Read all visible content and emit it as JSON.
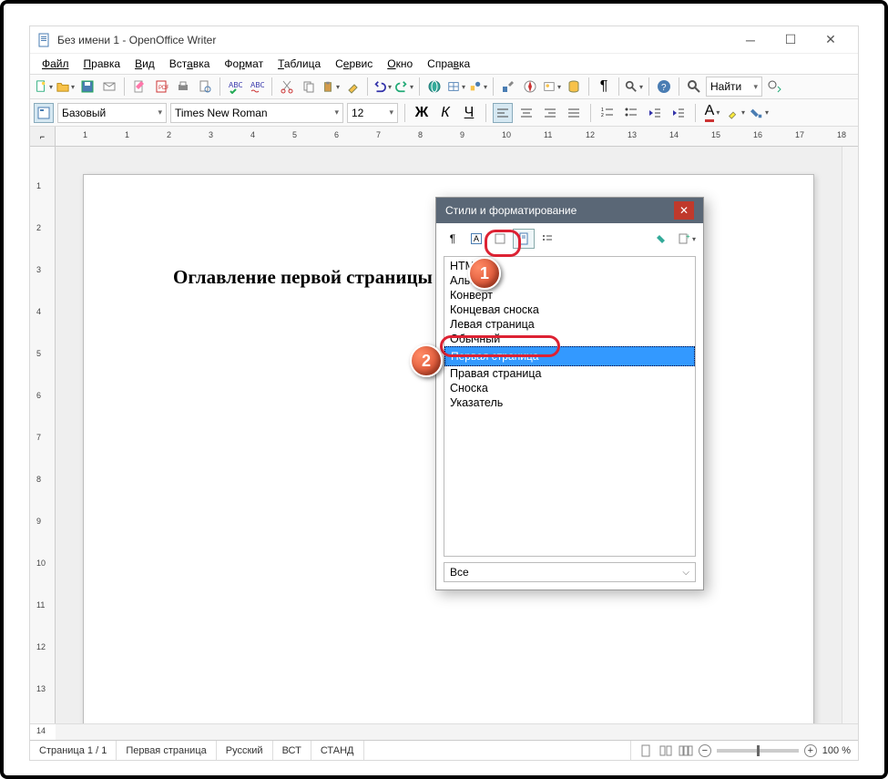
{
  "title": "Без имени 1 - OpenOffice Writer",
  "menus": [
    "Файл",
    "Правка",
    "Вид",
    "Вставка",
    "Формат",
    "Таблица",
    "Сервис",
    "Окно",
    "Справка"
  ],
  "formatbar": {
    "style": "Базовый",
    "font": "Times New Roman",
    "size": "12",
    "bold": "Ж",
    "italic": "К",
    "underline": "Ч",
    "fontcolor": "A"
  },
  "find_label": "Найти",
  "ruler_h": [
    "1",
    "1",
    "2",
    "3",
    "4",
    "5",
    "6",
    "7",
    "8",
    "9",
    "10",
    "11",
    "12",
    "13",
    "14",
    "15",
    "16",
    "17",
    "18"
  ],
  "ruler_v": [
    "1",
    "2",
    "3",
    "4",
    "5",
    "6",
    "7",
    "8",
    "9",
    "10",
    "11",
    "12",
    "13",
    "14"
  ],
  "document_heading": "Оглавление первой страницы",
  "status": {
    "page": "Страница 1 / 1",
    "style": "Первая страница",
    "lang": "Русский",
    "ins": "ВСТ",
    "std": "СТАНД",
    "zoom": "100 %"
  },
  "dialog": {
    "title": "Стили и форматирование",
    "items": [
      "HTML",
      "Альбомн",
      "Конверт",
      "Концевая сноска",
      "Левая страница",
      "Обычный",
      "Первая страница",
      "Правая страница",
      "Сноска",
      "Указатель"
    ],
    "selected_index": 6,
    "filter": "Все"
  },
  "markers": {
    "one": "1",
    "two": "2"
  }
}
